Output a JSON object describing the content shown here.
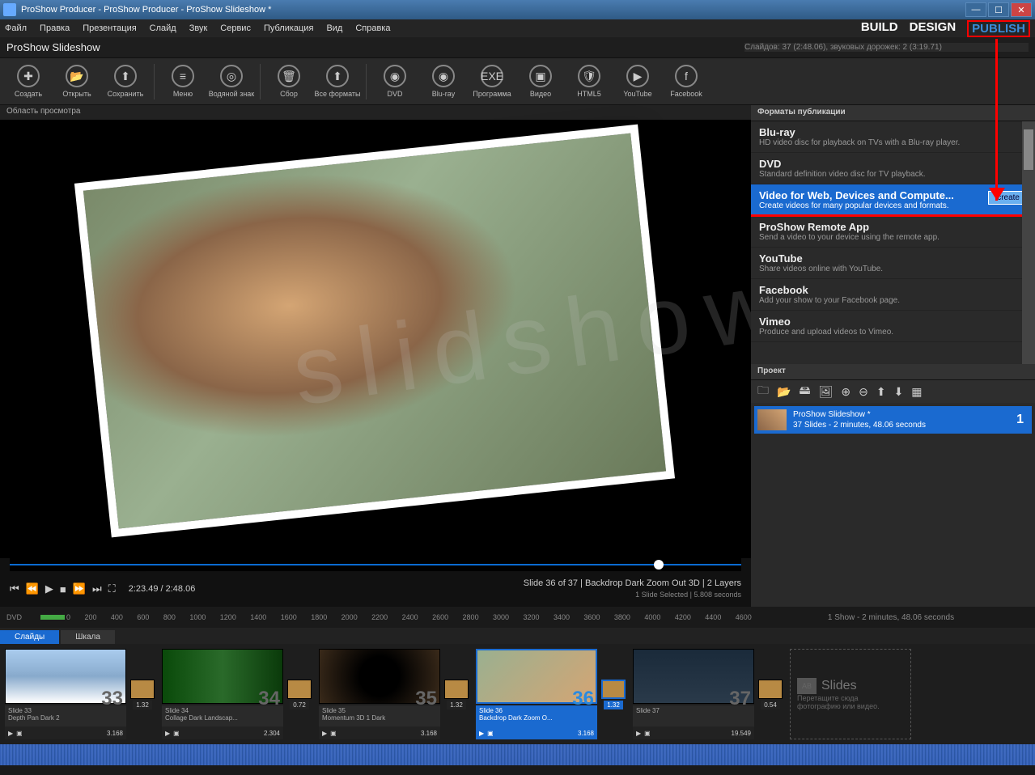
{
  "titlebar": {
    "title": "ProShow Producer - ProShow Producer - ProShow Slideshow *"
  },
  "menu": [
    "Файл",
    "Правка",
    "Презентация",
    "Слайд",
    "Звук",
    "Сервис",
    "Публикация",
    "Вид",
    "Справка"
  ],
  "modes": {
    "build": "BUILD",
    "design": "DESIGN",
    "publish": "PUBLISH"
  },
  "showrow": {
    "name": "ProShow Slideshow",
    "stats": "Слайдов: 37 (2:48.06), звуковых дорожек: 2 (3:19.71)"
  },
  "toolbar": [
    {
      "label": "Создать",
      "g": "✚"
    },
    {
      "label": "Открыть",
      "g": "📂"
    },
    {
      "label": "Сохранить",
      "g": "⬆"
    },
    {
      "sep": true
    },
    {
      "label": "Меню",
      "g": "≡"
    },
    {
      "label": "Водяной знак",
      "g": "◎"
    },
    {
      "sep": true
    },
    {
      "label": "Сбор",
      "g": "🗑"
    },
    {
      "label": "Все форматы",
      "g": "⬆"
    },
    {
      "sep": true
    },
    {
      "label": "DVD",
      "g": "◉"
    },
    {
      "label": "Blu-ray",
      "g": "◉"
    },
    {
      "label": "Программа",
      "g": "EXE"
    },
    {
      "label": "Видео",
      "g": "▣"
    },
    {
      "label": "HTML5",
      "g": "🛡"
    },
    {
      "label": "YouTube",
      "g": "▶"
    },
    {
      "label": "Facebook",
      "g": "f"
    }
  ],
  "preview": {
    "header": "Область просмотра"
  },
  "transport": {
    "time": "2:23.49 / 2:48.06",
    "line1": "Slide 36 of 37  |  Backdrop Dark Zoom Out 3D  |  2 Layers",
    "line2": "1 Slide Selected  |  5.808 seconds"
  },
  "publish": {
    "header": "Форматы публикации",
    "items": [
      {
        "t": "Blu-ray",
        "d": "HD video disc for playback on TVs with a Blu-ray player."
      },
      {
        "t": "DVD",
        "d": "Standard definition video disc for TV playback."
      },
      {
        "t": "Video for Web, Devices and Compute...",
        "d": "Create videos for many popular devices and formats.",
        "sel": true,
        "btn": "create"
      },
      {
        "t": "ProShow Remote App",
        "d": "Send a video to your device using the remote app."
      },
      {
        "t": "YouTube",
        "d": "Share videos online with YouTube."
      },
      {
        "t": "Facebook",
        "d": "Add your show to your Facebook page."
      },
      {
        "t": "Vimeo",
        "d": "Produce and upload videos to Vimeo."
      }
    ]
  },
  "project": {
    "header": "Проект",
    "item": {
      "title": "ProShow Slideshow *",
      "sub": "37 Slides - 2 minutes, 48.06 seconds",
      "num": "1"
    }
  },
  "ruler": {
    "label": "DVD",
    "ticks": [
      "0",
      "200",
      "400",
      "600",
      "800",
      "1000",
      "1200",
      "1400",
      "1600",
      "1800",
      "2000",
      "2200",
      "2400",
      "2600",
      "2800",
      "3000",
      "3200",
      "3400",
      "3600",
      "3800",
      "4000",
      "4200",
      "4400",
      "4600"
    ],
    "showinfo": "1 Show - 2 minutes, 48.06 seconds"
  },
  "tabs": {
    "slides": "Слайды",
    "scale": "Шкала"
  },
  "slides": [
    {
      "n": "33",
      "title": "Slide 33",
      "fx": "Depth Pan Dark 2",
      "dur": "3.168",
      "trans": "1.32",
      "cls": "i33"
    },
    {
      "n": "34",
      "title": "Slide 34",
      "fx": "Collage Dark Landscap...",
      "dur": "2.304",
      "trans": "0.72",
      "cls": "i34"
    },
    {
      "n": "35",
      "title": "Slide 35",
      "fx": "Momentum 3D 1 Dark",
      "dur": "3.168",
      "trans": "1.32",
      "cls": "i35"
    },
    {
      "n": "36",
      "title": "Slide 36",
      "fx": "Backdrop Dark Zoom O...",
      "dur": "3.168",
      "trans": "1.32",
      "cls": "i36",
      "sel": true
    },
    {
      "n": "37",
      "title": "Slide 37",
      "fx": "",
      "dur": "19.549",
      "trans": "0.54",
      "cls": "i37"
    }
  ],
  "dropzone": {
    "t": "Slides",
    "d1": "Перетащите сюда",
    "d2": "фотографию или видео."
  },
  "watermark": "slidshow"
}
